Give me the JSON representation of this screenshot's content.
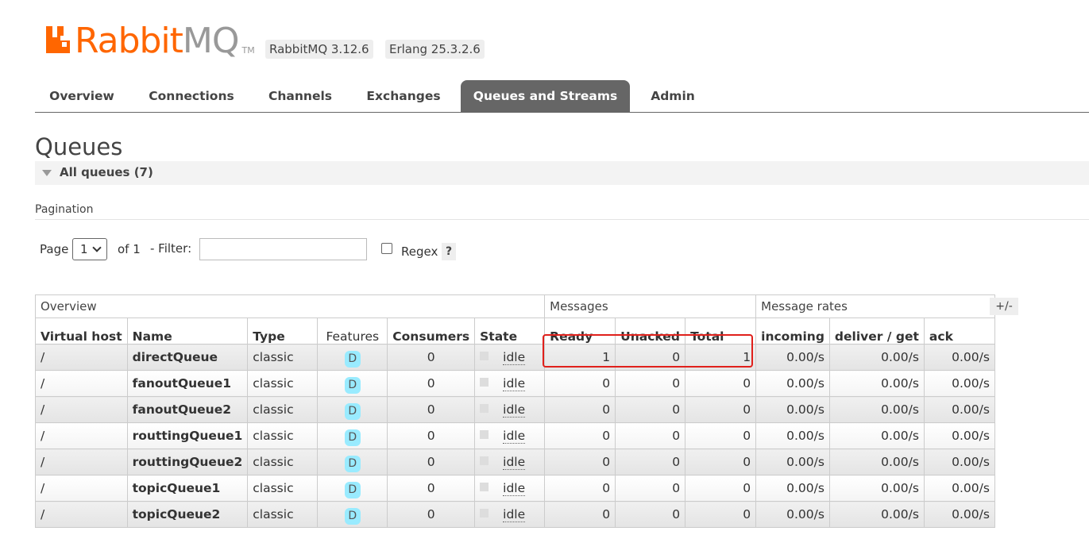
{
  "header": {
    "logo_text_rabbit": "Rabbit",
    "logo_text_mq": "MQ",
    "logo_tm": "TM",
    "rabbitmq_version": "RabbitMQ 3.12.6",
    "erlang_version": "Erlang 25.3.2.6",
    "brand_color": "#ff6600"
  },
  "nav": {
    "tabs": [
      {
        "label": "Overview",
        "active": false
      },
      {
        "label": "Connections",
        "active": false
      },
      {
        "label": "Channels",
        "active": false
      },
      {
        "label": "Exchanges",
        "active": false
      },
      {
        "label": "Queues and Streams",
        "active": true
      },
      {
        "label": "Admin",
        "active": false
      }
    ]
  },
  "page": {
    "title": "Queues",
    "section_toggle": "All queues (7)"
  },
  "pagination": {
    "section_label": "Pagination",
    "page_label": "Page",
    "page_value": "1",
    "of_label": "of 1",
    "filter_label": "- Filter:",
    "filter_value": "",
    "regex_label": "Regex",
    "regex_checked": false,
    "help_label": "?"
  },
  "table": {
    "group_headers": {
      "overview": "Overview",
      "messages": "Messages",
      "rates": "Message rates"
    },
    "columns": [
      "Virtual host",
      "Name",
      "Type",
      "Features",
      "Consumers",
      "State",
      "Ready",
      "Unacked",
      "Total",
      "incoming",
      "deliver / get",
      "ack"
    ],
    "column_toggle": "+/-",
    "rows": [
      {
        "vhost": "/",
        "name": "directQueue",
        "type": "classic",
        "feature": "D",
        "consumers": "0",
        "state": "idle",
        "ready": "1",
        "unacked": "0",
        "total": "1",
        "incoming": "0.00/s",
        "deliver_get": "0.00/s",
        "ack": "0.00/s"
      },
      {
        "vhost": "/",
        "name": "fanoutQueue1",
        "type": "classic",
        "feature": "D",
        "consumers": "0",
        "state": "idle",
        "ready": "0",
        "unacked": "0",
        "total": "0",
        "incoming": "0.00/s",
        "deliver_get": "0.00/s",
        "ack": "0.00/s"
      },
      {
        "vhost": "/",
        "name": "fanoutQueue2",
        "type": "classic",
        "feature": "D",
        "consumers": "0",
        "state": "idle",
        "ready": "0",
        "unacked": "0",
        "total": "0",
        "incoming": "0.00/s",
        "deliver_get": "0.00/s",
        "ack": "0.00/s"
      },
      {
        "vhost": "/",
        "name": "routtingQueue1",
        "type": "classic",
        "feature": "D",
        "consumers": "0",
        "state": "idle",
        "ready": "0",
        "unacked": "0",
        "total": "0",
        "incoming": "0.00/s",
        "deliver_get": "0.00/s",
        "ack": "0.00/s"
      },
      {
        "vhost": "/",
        "name": "routtingQueue2",
        "type": "classic",
        "feature": "D",
        "consumers": "0",
        "state": "idle",
        "ready": "0",
        "unacked": "0",
        "total": "0",
        "incoming": "0.00/s",
        "deliver_get": "0.00/s",
        "ack": "0.00/s"
      },
      {
        "vhost": "/",
        "name": "topicQueue1",
        "type": "classic",
        "feature": "D",
        "consumers": "0",
        "state": "idle",
        "ready": "0",
        "unacked": "0",
        "total": "0",
        "incoming": "0.00/s",
        "deliver_get": "0.00/s",
        "ack": "0.00/s"
      },
      {
        "vhost": "/",
        "name": "topicQueue2",
        "type": "classic",
        "feature": "D",
        "consumers": "0",
        "state": "idle",
        "ready": "0",
        "unacked": "0",
        "total": "0",
        "incoming": "0.00/s",
        "deliver_get": "0.00/s",
        "ack": "0.00/s"
      }
    ]
  },
  "annotation": {
    "highlight_color": "#e0201b"
  }
}
